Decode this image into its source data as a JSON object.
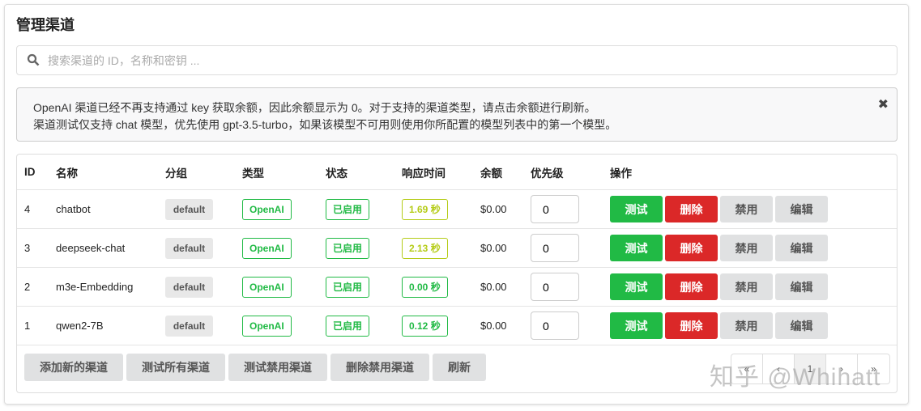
{
  "title": "管理渠道",
  "search": {
    "placeholder": "搜索渠道的 ID，名称和密钥 ..."
  },
  "alert": {
    "line1": "OpenAI 渠道已经不再支持通过 key 获取余额，因此余额显示为 0。对于支持的渠道类型，请点击余额进行刷新。",
    "line2": "渠道测试仅支持 chat 模型，优先使用 gpt-3.5-turbo，如果该模型不可用则使用你所配置的模型列表中的第一个模型。",
    "close": "✖"
  },
  "columns": [
    "ID",
    "名称",
    "分组",
    "类型",
    "状态",
    "响应时间",
    "余额",
    "优先级",
    "操作"
  ],
  "rows": [
    {
      "id": "4",
      "name": "chatbot",
      "group": "default",
      "type": "OpenAI",
      "status": "已启用",
      "time": "1.69 秒",
      "time_color": "olive",
      "balance": "$0.00",
      "priority": "0"
    },
    {
      "id": "3",
      "name": "deepseek-chat",
      "group": "default",
      "type": "OpenAI",
      "status": "已启用",
      "time": "2.13 秒",
      "time_color": "olive",
      "balance": "$0.00",
      "priority": "0"
    },
    {
      "id": "2",
      "name": "m3e-Embedding",
      "group": "default",
      "type": "OpenAI",
      "status": "已启用",
      "time": "0.00 秒",
      "time_color": "green",
      "balance": "$0.00",
      "priority": "0"
    },
    {
      "id": "1",
      "name": "qwen2-7B",
      "group": "default",
      "type": "OpenAI",
      "status": "已启用",
      "time": "0.12 秒",
      "time_color": "green",
      "balance": "$0.00",
      "priority": "0"
    }
  ],
  "actions": {
    "test": "测试",
    "delete": "删除",
    "disable": "禁用",
    "edit": "编辑"
  },
  "footer": [
    "添加新的渠道",
    "测试所有渠道",
    "测试禁用渠道",
    "删除禁用渠道",
    "刷新"
  ],
  "pagination": [
    "«",
    "‹",
    "1",
    "›",
    "»"
  ],
  "watermark": "知乎 @Whihatt",
  "colors": {
    "green": "#21ba45",
    "red": "#db2828",
    "olive": "#b5cc18"
  }
}
